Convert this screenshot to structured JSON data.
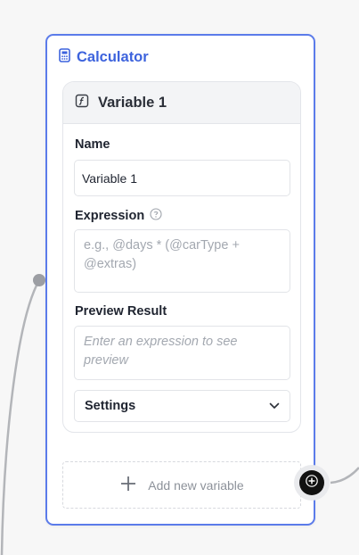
{
  "node": {
    "title": "Calculator",
    "icon": "calculator-icon"
  },
  "variable": {
    "title": "Variable 1",
    "icon": "function-icon",
    "name_label": "Name",
    "name_value": "Variable 1",
    "expression_label": "Expression",
    "expression_placeholder": "e.g., @days * (@carType + @extras)",
    "preview_label": "Preview Result",
    "preview_placeholder": "Enter an expression to see preview",
    "settings_label": "Settings"
  },
  "add_variable": {
    "label": "Add new variable"
  },
  "colors": {
    "accent": "#3d63dd",
    "node_border": "#5b7bea",
    "edge": "#b0b2b6"
  }
}
